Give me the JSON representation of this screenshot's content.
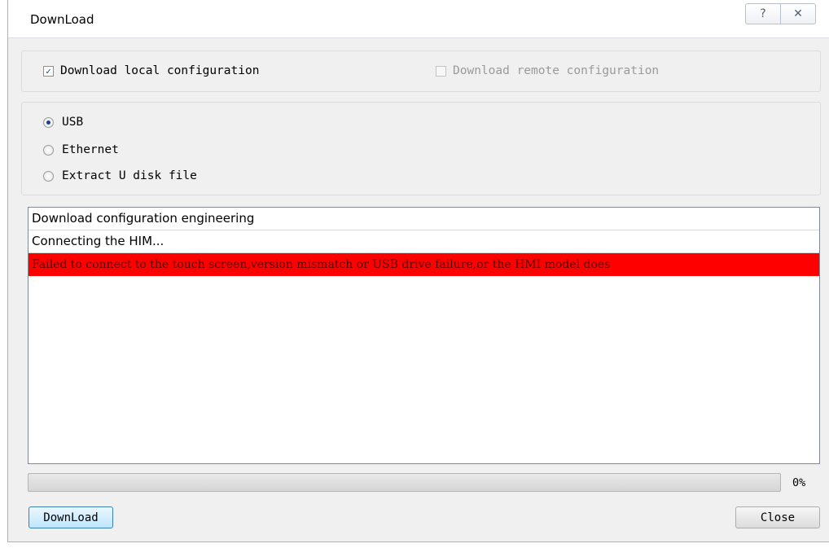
{
  "window": {
    "title": "DownLoad",
    "help_glyph": "?",
    "close_glyph": "✕"
  },
  "target": {
    "local_label": "Download local configuration",
    "local_checked": true,
    "remote_label": "Download remote configuration",
    "remote_checked": false,
    "remote_enabled": false
  },
  "connection": {
    "options": [
      {
        "label": "USB",
        "selected": true
      },
      {
        "label": "Ethernet",
        "selected": false
      },
      {
        "label": "Extract U disk file",
        "selected": false
      }
    ]
  },
  "log": {
    "lines": [
      {
        "text": "Download configuration engineering",
        "type": "info"
      },
      {
        "text": "Connecting the HIM...",
        "type": "info"
      },
      {
        "text": "Failed to connect to the touch screen,version mismatch or USB drive failure,or the HMI model does",
        "type": "error"
      }
    ]
  },
  "progress": {
    "value": 0,
    "text": "0%"
  },
  "buttons": {
    "download": "DownLoad",
    "close": "Close"
  },
  "colors": {
    "error_bg": "#ff0000",
    "error_text": "#5a0000",
    "window_bg": "#f0f0f0"
  }
}
